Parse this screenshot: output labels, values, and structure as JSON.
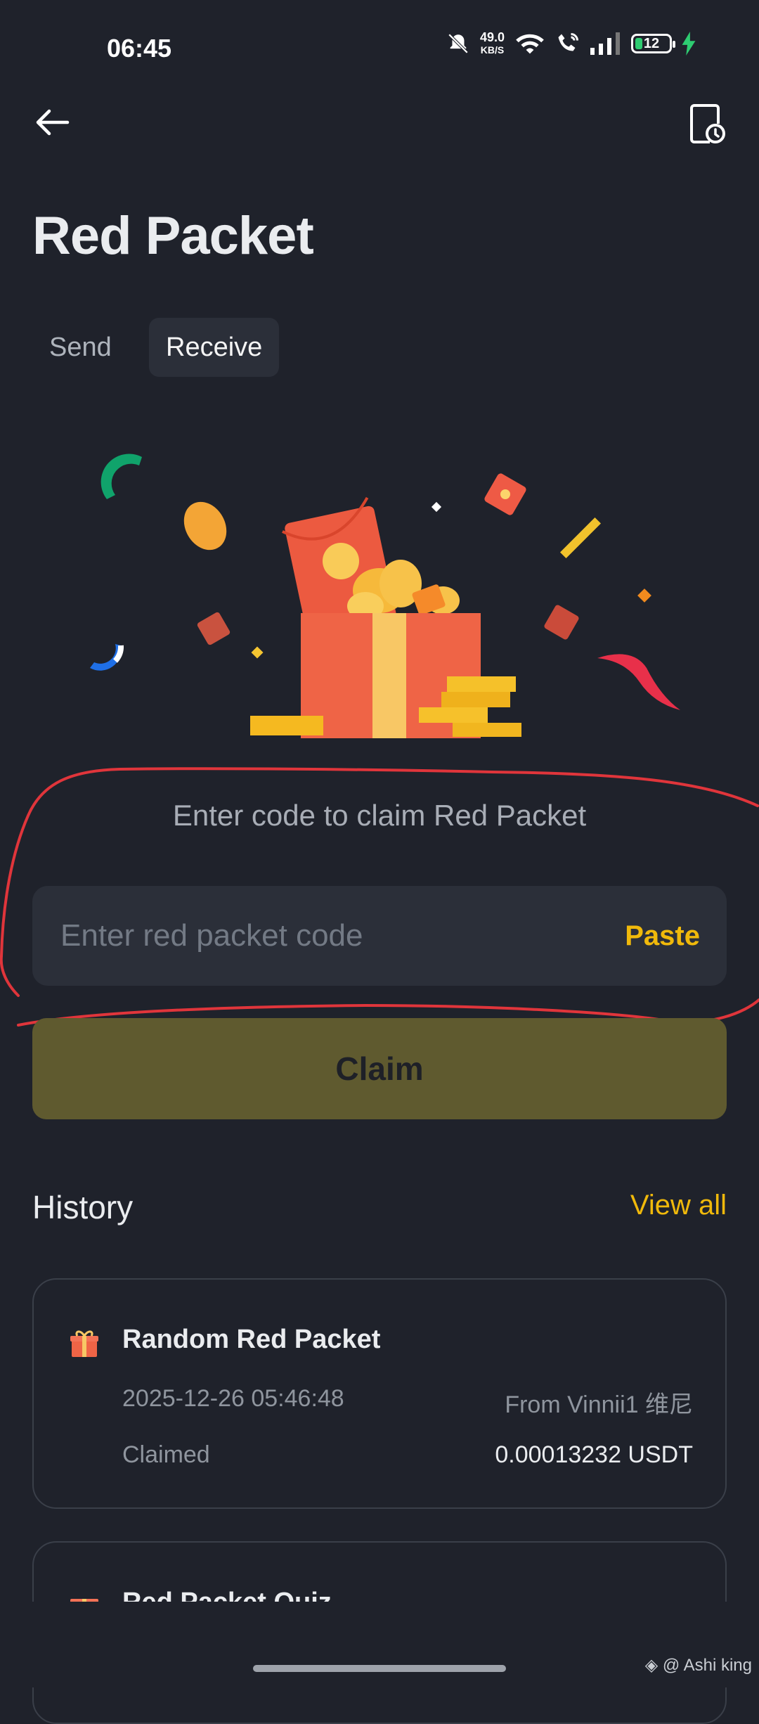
{
  "status_bar": {
    "time": "06:45",
    "net_speed": "49.0",
    "net_unit": "KB/S",
    "battery": "12"
  },
  "header": {
    "title": "Red Packet"
  },
  "tabs": [
    {
      "label": "Send",
      "active": false
    },
    {
      "label": "Receive",
      "active": true
    }
  ],
  "claim": {
    "hint": "Enter code to claim Red Packet",
    "placeholder": "Enter red packet code",
    "value": "",
    "paste_label": "Paste",
    "claim_label": "Claim"
  },
  "history": {
    "title": "History",
    "view_all_label": "View all",
    "items": [
      {
        "icon": "gift-icon",
        "title": "Random Red Packet",
        "datetime": "2025-12-26 05:46:48",
        "from": "From Vinnii1 维尼",
        "status": "Claimed",
        "amount": "0.00013232 USDT"
      },
      {
        "icon": "gift-icon",
        "title": "Red Packet Quiz"
      }
    ]
  },
  "watermark": "@ Ashi king",
  "colors": {
    "background": "#1f222b",
    "accent": "#f0b90b",
    "card": "#2b2f39",
    "claim_button_disabled": "#5f5a2f",
    "annotation_stroke": "#e0353b"
  }
}
